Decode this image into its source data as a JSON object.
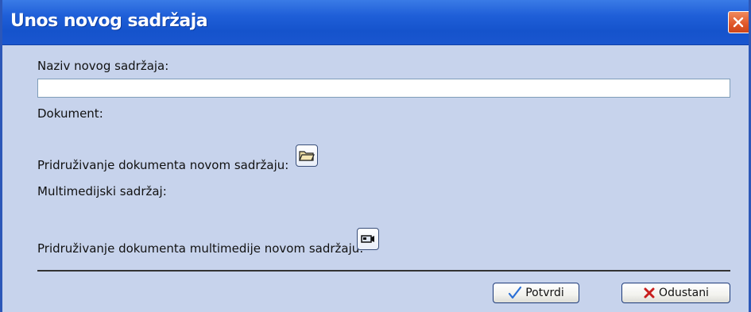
{
  "window": {
    "title": "Unos novog sadržaja"
  },
  "form": {
    "name_label": "Naziv novog sadržaja:",
    "name_value": "",
    "document_label": "Dokument:",
    "attach_document_label": "Pridruživanje dokumenta novom sadržaju:",
    "multimedia_label": "Multimedijski sadržaj:",
    "attach_multimedia_label": "Pridruživanje dokumenta multimedije novom sadržaju:"
  },
  "buttons": {
    "confirm_label": "Potvrdi",
    "cancel_label": "Odustani"
  },
  "icons": {
    "close": "close-icon",
    "folder": "folder-icon",
    "camera": "video-camera-icon",
    "check": "check-icon",
    "cross": "x-icon"
  },
  "colors": {
    "titlebar": "#1f5fd8",
    "dialog_bg": "#c7d3ec",
    "close_button": "#e0572a",
    "check": "#2a6fd6",
    "cancel_x": "#c81e1e"
  }
}
